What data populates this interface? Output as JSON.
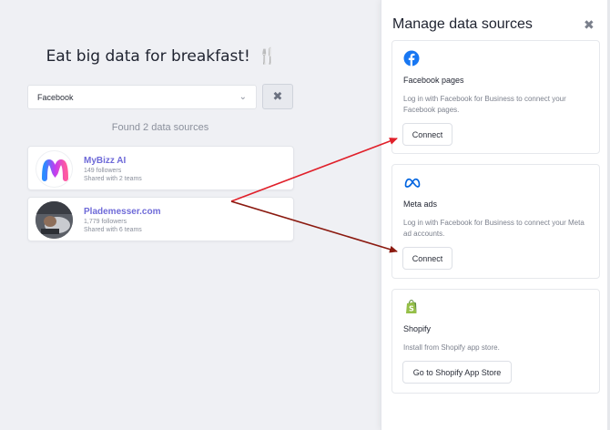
{
  "main": {
    "headline": "Eat big data for breakfast!",
    "headline_icon": "fork-knife-icon",
    "select": {
      "value": "Facebook"
    },
    "found_text": "Found 2 data sources",
    "sources": [
      {
        "name": "MyBizz AI",
        "followers": "149 followers",
        "shared": "Shared with 2 teams"
      },
      {
        "name": "Plademesser.com",
        "followers": "1,779 followers",
        "shared": "Shared with 6 teams"
      }
    ]
  },
  "panel": {
    "title": "Manage data sources",
    "cards": [
      {
        "name": "Facebook pages",
        "description": "Log in with Facebook for Business to connect your Facebook pages.",
        "button": "Connect",
        "icon": "facebook-icon"
      },
      {
        "name": "Meta ads",
        "description": "Log in with Facebook for Business to connect your Meta ad accounts.",
        "button": "Connect",
        "icon": "meta-icon"
      },
      {
        "name": "Shopify",
        "description": "Install from Shopify app store.",
        "button": "Go to Shopify App Store",
        "icon": "shopify-icon"
      }
    ]
  },
  "colors": {
    "accent": "#6e6ad8",
    "facebook": "#1877f2",
    "meta": "#0064e0",
    "shopify": "#95bf47",
    "arrow_red": "#e0202a",
    "arrow_dark": "#8b1a10"
  }
}
